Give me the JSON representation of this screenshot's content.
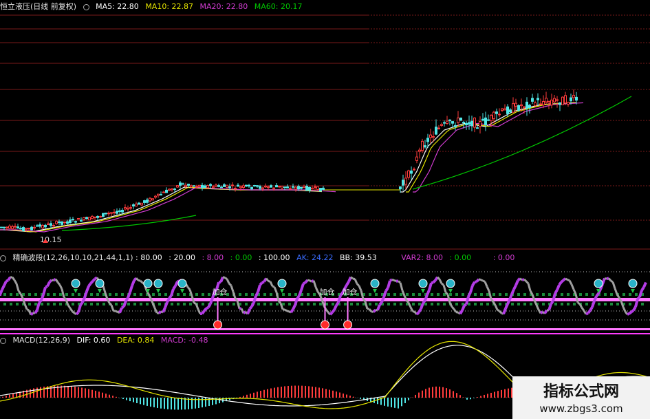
{
  "colors": {
    "background": "#000000",
    "grid": "#7a1a1a",
    "ma5": "#ffffff",
    "ma10": "#e6e600",
    "ma20": "#d23cd2",
    "ma60": "#00c800",
    "candle_up": "#ff3c3c",
    "candle_down": "#50e6e6",
    "wave_up": "#b43ce6",
    "wave_down": "#a0a0a0",
    "band": "#ff78ff",
    "signal": "#ff2a2a",
    "macd_dif": "#ffffff",
    "macd_dea": "#e6e600",
    "macd_pos": "#ff3c3c",
    "macd_neg": "#50e6e6"
  },
  "price_panel": {
    "title": "恒立液压(日线 前复权)",
    "icon": "circle-toggle-icon",
    "ma5": "MA5: 22.80",
    "ma10": "MA10: 22.87",
    "ma20": "MA20: 22.80",
    "ma60": "MA60: 20.17",
    "low_label": "10.15"
  },
  "wave_panel": {
    "title": "精确波段(12,26,10,10,21,44,1,1)",
    "v1": ": 80.00",
    "v2": ": 20.00",
    "v3": ": 8.00",
    "v4": ": 0.00",
    "v5": ": 100.00",
    "ak": "AK: 24.22",
    "bb": "BB: 39.53",
    "var2": "VAR2: 8.00",
    "v6": ": 0.00",
    "v7": ": 0.00",
    "add_label": "加仓",
    "add_positions": [
      0.335,
      0.5,
      0.535
    ]
  },
  "macd_panel": {
    "title": "MACD(12,26,9)",
    "dif": "DIF: 0.60",
    "dea": "DEA: 0.84",
    "macd": "MACD: -0.48"
  },
  "watermark": {
    "line1": "指标公式网",
    "line2": "www.zbgs3.com"
  },
  "chart_data": {
    "type": "candlestick",
    "series": [
      {
        "name": "MA5",
        "values": [
          22.8
        ]
      },
      {
        "name": "MA10",
        "values": [
          22.87
        ]
      },
      {
        "name": "MA20",
        "values": [
          22.8
        ]
      },
      {
        "name": "MA60",
        "values": [
          20.17
        ]
      }
    ],
    "annotations": [
      "10.15"
    ]
  }
}
